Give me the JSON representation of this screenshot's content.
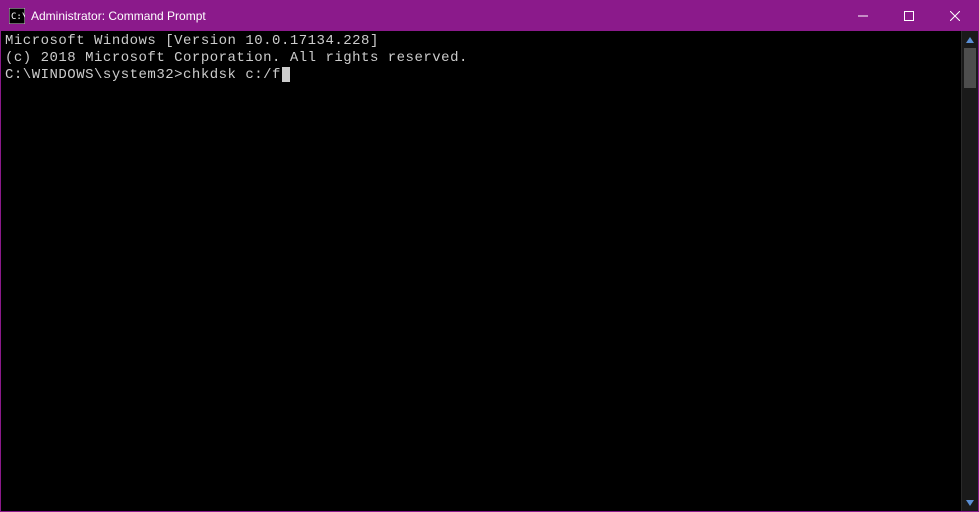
{
  "titlebar": {
    "title": "Administrator: Command Prompt"
  },
  "terminal": {
    "line1": "Microsoft Windows [Version 10.0.17134.228]",
    "line2": "(c) 2018 Microsoft Corporation. All rights reserved.",
    "blank": "",
    "prompt": "C:\\WINDOWS\\system32>",
    "command": "chkdsk c:/f"
  }
}
